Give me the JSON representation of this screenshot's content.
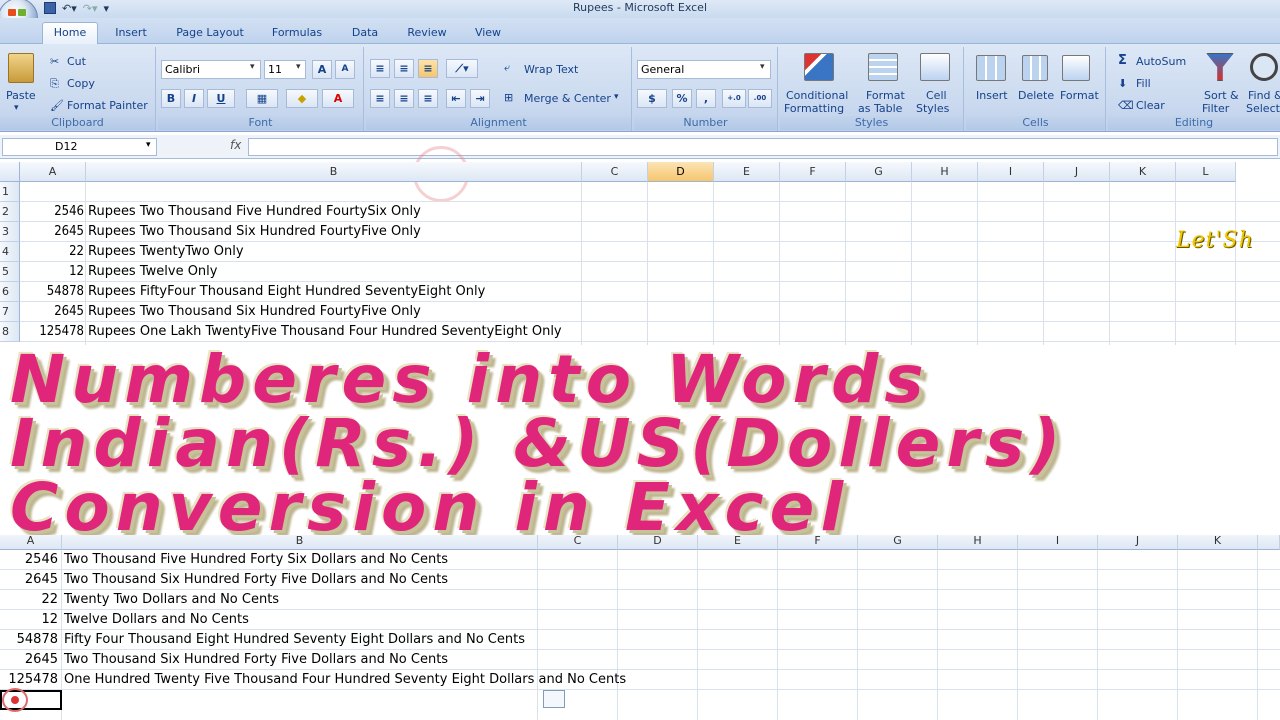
{
  "window": {
    "title": "Rupees - Microsoft Excel"
  },
  "ribbon": {
    "tabs": [
      "Home",
      "Insert",
      "Page Layout",
      "Formulas",
      "Data",
      "Review",
      "View"
    ],
    "clipboard": {
      "paste": "Paste",
      "cut": "Cut",
      "copy": "Copy",
      "format_painter": "Format Painter",
      "label": "Clipboard"
    },
    "font": {
      "name": "Calibri",
      "size": "11",
      "label": "Font",
      "bold": "B",
      "italic": "I",
      "underline": "U"
    },
    "alignment": {
      "wrap_text": "Wrap Text",
      "merge_center": "Merge & Center",
      "label": "Alignment"
    },
    "number": {
      "format": "General",
      "currency": "$",
      "percent": "%",
      "comma": ",",
      "inc_decimal": "+.0 .00",
      "dec_decimal": ".00 →.0",
      "label": "Number"
    },
    "styles": {
      "conditional": "Conditional",
      "conditional2": "Formatting",
      "format_as": "Format",
      "format_as2": "as Table",
      "cell": "Cell",
      "cell2": "Styles",
      "label": "Styles"
    },
    "cells": {
      "insert": "Insert",
      "delete": "Delete",
      "format": "Format",
      "label": "Cells"
    },
    "editing": {
      "autosum": "AutoSum",
      "fill": "Fill",
      "clear": "Clear",
      "sort": "Sort &",
      "sort2": "Filter",
      "find": "Find &",
      "find2": "Select",
      "label": "Editing"
    }
  },
  "formula_bar": {
    "name_box": "D12",
    "fx": "fx",
    "value": ""
  },
  "columns_top": [
    "A",
    "B",
    "C",
    "D",
    "E",
    "F",
    "G",
    "H",
    "I",
    "J",
    "K",
    "L"
  ],
  "rows_top": [
    {
      "num": "1",
      "a": "",
      "b": ""
    },
    {
      "num": "2",
      "a": "2546",
      "b": "Rupees Two Thousand Five Hundred FourtySix Only"
    },
    {
      "num": "3",
      "a": "2645",
      "b": "Rupees Two Thousand Six Hundred FourtyFive Only"
    },
    {
      "num": "4",
      "a": "22",
      "b": "Rupees TwentyTwo Only"
    },
    {
      "num": "5",
      "a": "12",
      "b": "Rupees Twelve Only"
    },
    {
      "num": "6",
      "a": "54878",
      "b": "Rupees FiftyFour Thousand Eight Hundred SeventyEight Only"
    },
    {
      "num": "7",
      "a": "2645",
      "b": "Rupees Two Thousand Six Hundred FourtyFive Only"
    },
    {
      "num": "8",
      "a": "125478",
      "b": "Rupees One Lakh TwentyFive Thousand Four Hundred SeventyEight Only"
    }
  ],
  "overlay": {
    "line1": "Numberes into Words",
    "line2": "Indian(Rs.) &US(Dollers)",
    "line3": "Conversion in Excel",
    "watermark": "Let'Sh"
  },
  "columns_bottom": [
    "A",
    "B",
    "C",
    "D",
    "E",
    "F",
    "G",
    "H",
    "I",
    "J",
    "K"
  ],
  "rows_bottom": [
    {
      "a": "2546",
      "b": "Two Thousand Five Hundred Forty Six Dollars and No Cents"
    },
    {
      "a": "2645",
      "b": "Two Thousand Six Hundred Forty Five Dollars and No Cents"
    },
    {
      "a": "22",
      "b": "Twenty Two Dollars and No Cents"
    },
    {
      "a": "12",
      "b": "Twelve Dollars and No Cents"
    },
    {
      "a": "54878",
      "b": "Fifty Four Thousand Eight Hundred Seventy Eight Dollars and No Cents"
    },
    {
      "a": "2645",
      "b": "Two Thousand Six Hundred Forty Five Dollars and No Cents"
    },
    {
      "a": "125478",
      "b": "One Hundred Twenty Five Thousand Four Hundred Seventy Eight Dollars and No Cents"
    }
  ],
  "colors": {
    "title_text": "#e0267a",
    "selected_col": "#f7c56e",
    "watermark": "#f0c800"
  }
}
